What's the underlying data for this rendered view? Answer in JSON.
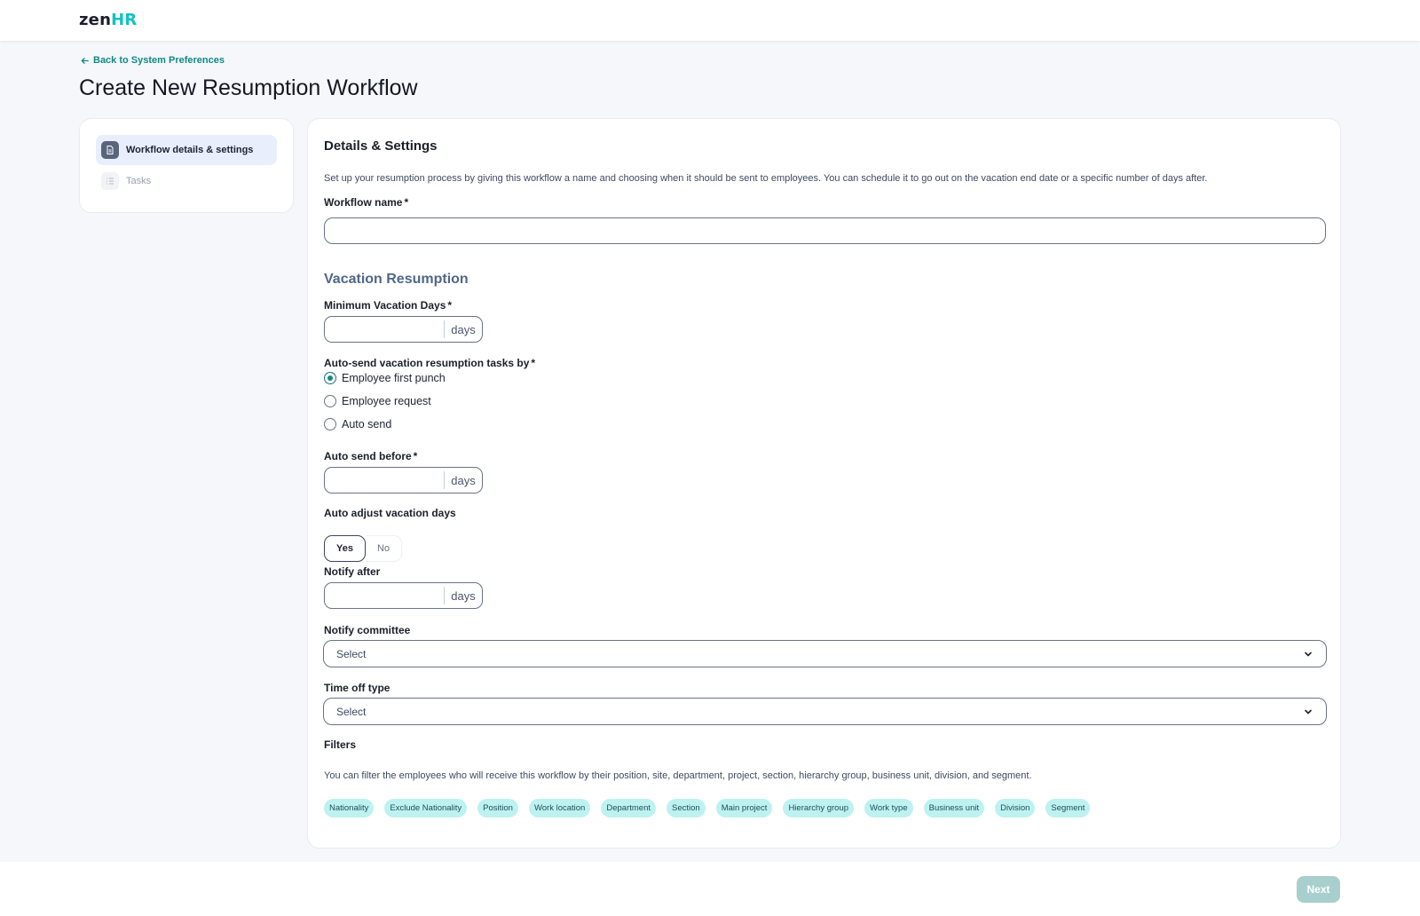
{
  "brand": {
    "logo_zen": "zen",
    "logo_hr": "HR"
  },
  "nav": {
    "back_label": "Back to System Preferences"
  },
  "page": {
    "title": "Create New Resumption Workflow"
  },
  "steps": [
    {
      "label": "Workflow details & settings",
      "icon": "document-icon",
      "active": true
    },
    {
      "label": "Tasks",
      "icon": "list-icon",
      "active": false
    }
  ],
  "details": {
    "title": "Details & Settings",
    "description": "Set up your resumption process by giving this workflow a name and choosing when it should be sent to employees. You can schedule it to go out on the vacation end date or a specific number of days after.",
    "workflow_name_label": "Workflow name",
    "required_mark": "*",
    "workflow_name_value": ""
  },
  "vacation": {
    "heading": "Vacation Resumption",
    "min_days_label": "Minimum Vacation Days",
    "days_unit": "days",
    "auto_send_by_label": "Auto-send vacation resumption tasks by",
    "auto_send_options": [
      {
        "label": "Employee first punch",
        "checked": true
      },
      {
        "label": "Employee request",
        "checked": false
      },
      {
        "label": "Auto send",
        "checked": false
      }
    ],
    "auto_send_before_label": "Auto send before",
    "auto_adjust_label": "Auto adjust vacation days",
    "auto_adjust_yes": "Yes",
    "auto_adjust_no": "No",
    "auto_adjust_selected": "Yes",
    "notify_after_label": "Notify after",
    "notify_committee_label": "Notify committee",
    "notify_committee_value": "Select",
    "time_off_type_label": "Time off type",
    "time_off_type_value": "Select"
  },
  "filters": {
    "label": "Filters",
    "description": "You can filter the employees who will receive this workflow by their position, site, department, project, section, hierarchy group, business unit, division, and segment.",
    "chips": [
      "Nationality",
      "Exclude Nationality",
      "Position",
      "Work location",
      "Department",
      "Section",
      "Main project",
      "Hierarchy group",
      "Work type",
      "Business unit",
      "Division",
      "Segment"
    ]
  },
  "footer": {
    "next_label": "Next"
  },
  "colors": {
    "accent": "#0f8a85",
    "brand_hr": "#12c3c0",
    "chip_bg": "#bdf2f1",
    "next_disabled": "#a8cfcd",
    "subheading": "#4f6789"
  }
}
